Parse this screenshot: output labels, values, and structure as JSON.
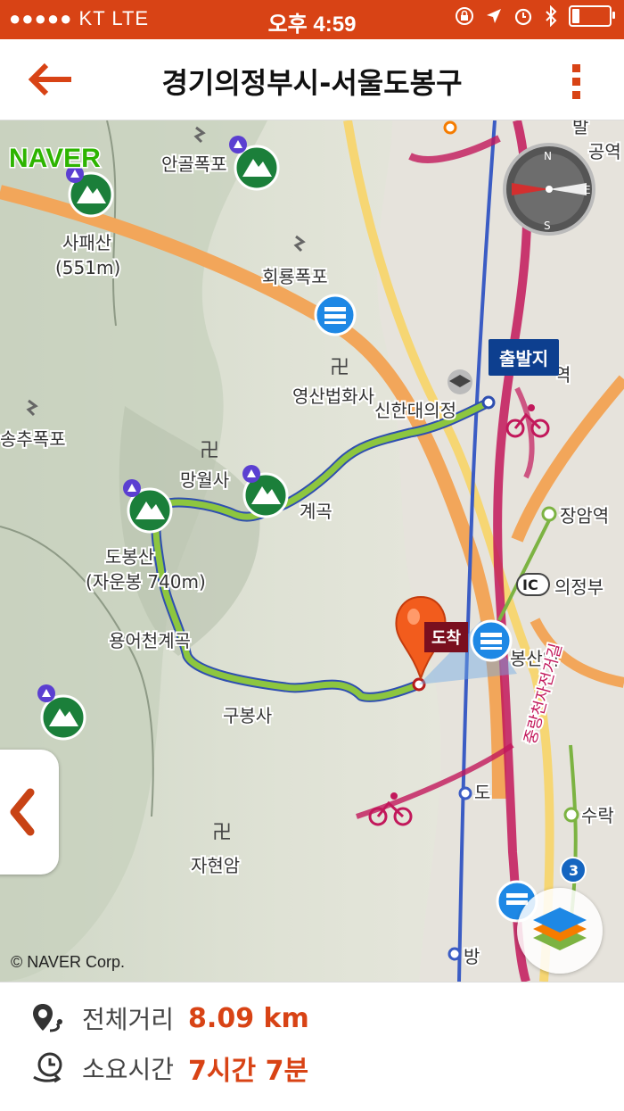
{
  "status_bar": {
    "carrier": "●●●●● KT   LTE",
    "time": "오후 4:59",
    "battery_level": 0.2
  },
  "header": {
    "title": "경기의정부시-서울도봉구",
    "back_icon": "back-arrow-icon",
    "menu_icon": "more-vertical-icon",
    "accent_color": "#d84315"
  },
  "map": {
    "brand": "NAVER",
    "copyright": "© NAVER Corp.",
    "start_label": "출발지",
    "end_label": "도착",
    "labels": {
      "angolpokpo": "안골폭포",
      "sapaesan": "사패산",
      "sapaesan_height": "(551m)",
      "hoeryongpokpo": "회룡폭포",
      "yeongsan": "영산법화사",
      "sinhan": "신한대의정",
      "songchu": "송추폭포",
      "mangwolsa": "망월사",
      "gyegok": "계곡",
      "dobongsan": "도봉산",
      "jaunbong": "(자운봉 740m)",
      "yongeocheon": "용어천계곡",
      "gubongsa": "구봉사",
      "jahyeonam": "자현암",
      "jangamyeok": "장암역",
      "ic_uijeongbu": "의정부",
      "ic": "IC",
      "dobongsanyeok": "봉산역",
      "surak": "수락",
      "bikeroad": "중랑천자전거길",
      "route3": "3",
      "bang": "방",
      "no": "도",
      "yeok": "역",
      "gongyeok": "공역",
      "baltop": "발"
    },
    "route_color": "#8dc63f",
    "icons": [
      "mountain-icon",
      "waterfall-icon",
      "temple-icon",
      "bus-icon",
      "bicycle-icon",
      "compass-icon",
      "layers-icon",
      "collapse-icon",
      "pin-icon",
      "school-icon"
    ]
  },
  "summary": {
    "distance_label": "전체거리",
    "distance_value": "8.09 km",
    "time_label": "소요시간",
    "time_value": "7시간  7분"
  }
}
